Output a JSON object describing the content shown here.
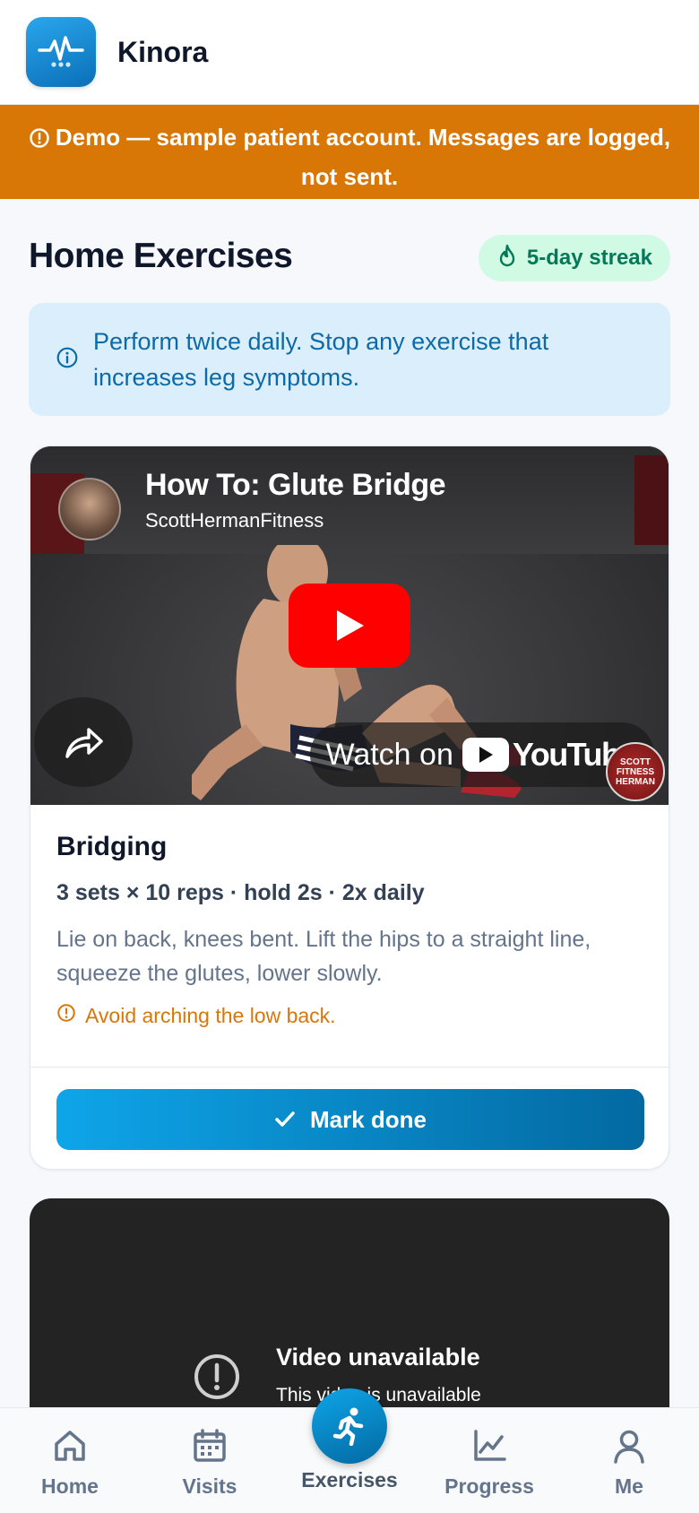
{
  "app": {
    "name": "Kinora"
  },
  "banner": {
    "text": "Demo — sample patient account. Messages are logged, not sent."
  },
  "page": {
    "title": "Home Exercises",
    "streak": "5-day streak"
  },
  "info": {
    "text": "Perform twice daily. Stop any exercise that increases leg symptoms."
  },
  "exercises": [
    {
      "video": {
        "title": "How To: Glute Bridge",
        "channel": "ScottHermanFitness",
        "watch_on": "Watch on",
        "platform": "YouTube",
        "badge": "SCOTT FITNESS HERMAN"
      },
      "name": "Bridging",
      "meta": "3 sets × 10 reps · hold 2s · 2x daily",
      "description": "Lie on back, knees bent. Lift the hips to a straight line, squeeze the glutes, lower slowly.",
      "warning": "Avoid arching the low back.",
      "action": "Mark done"
    },
    {
      "video": {
        "unavailable_title": "Video unavailable",
        "unavailable_sub": "This video is unavailable"
      }
    }
  ],
  "nav": {
    "items": [
      {
        "label": "Home",
        "icon": "home-icon"
      },
      {
        "label": "Visits",
        "icon": "calendar-icon"
      },
      {
        "label": "Exercises",
        "icon": "running-icon",
        "active": true
      },
      {
        "label": "Progress",
        "icon": "chart-line-icon"
      },
      {
        "label": "Me",
        "icon": "user-icon"
      }
    ]
  },
  "colors": {
    "brand": "#0ea5e9",
    "banner": "#d97706",
    "streak_bg": "#d1fae5",
    "warning": "#d97706",
    "youtube_red": "#ff0000"
  }
}
